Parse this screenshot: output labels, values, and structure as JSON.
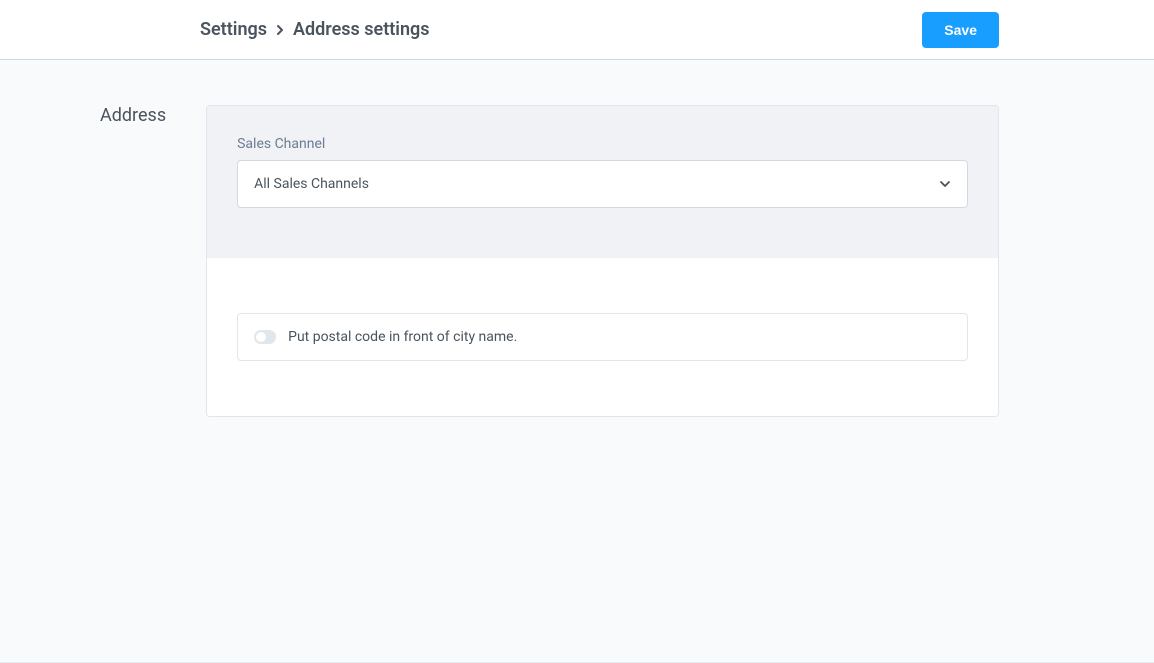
{
  "header": {
    "breadcrumb_root": "Settings",
    "breadcrumb_current": "Address settings",
    "save_label": "Save"
  },
  "sidebar": {
    "section_title": "Address"
  },
  "form": {
    "sales_channel_label": "Sales Channel",
    "sales_channel_value": "All Sales Channels",
    "postal_toggle_label": "Put postal code in front of city name.",
    "postal_toggle_on": false
  }
}
